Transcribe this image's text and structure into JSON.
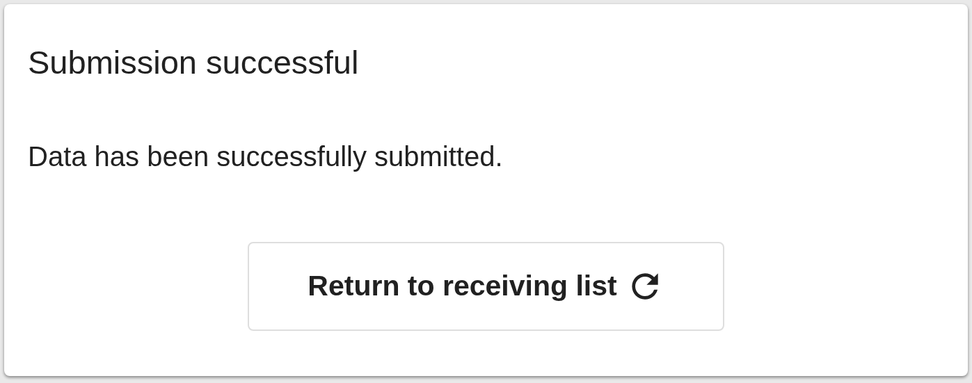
{
  "dialog": {
    "title": "Submission successful",
    "message": "Data has been successfully submitted.",
    "button": {
      "label": "Return to receiving list"
    }
  }
}
